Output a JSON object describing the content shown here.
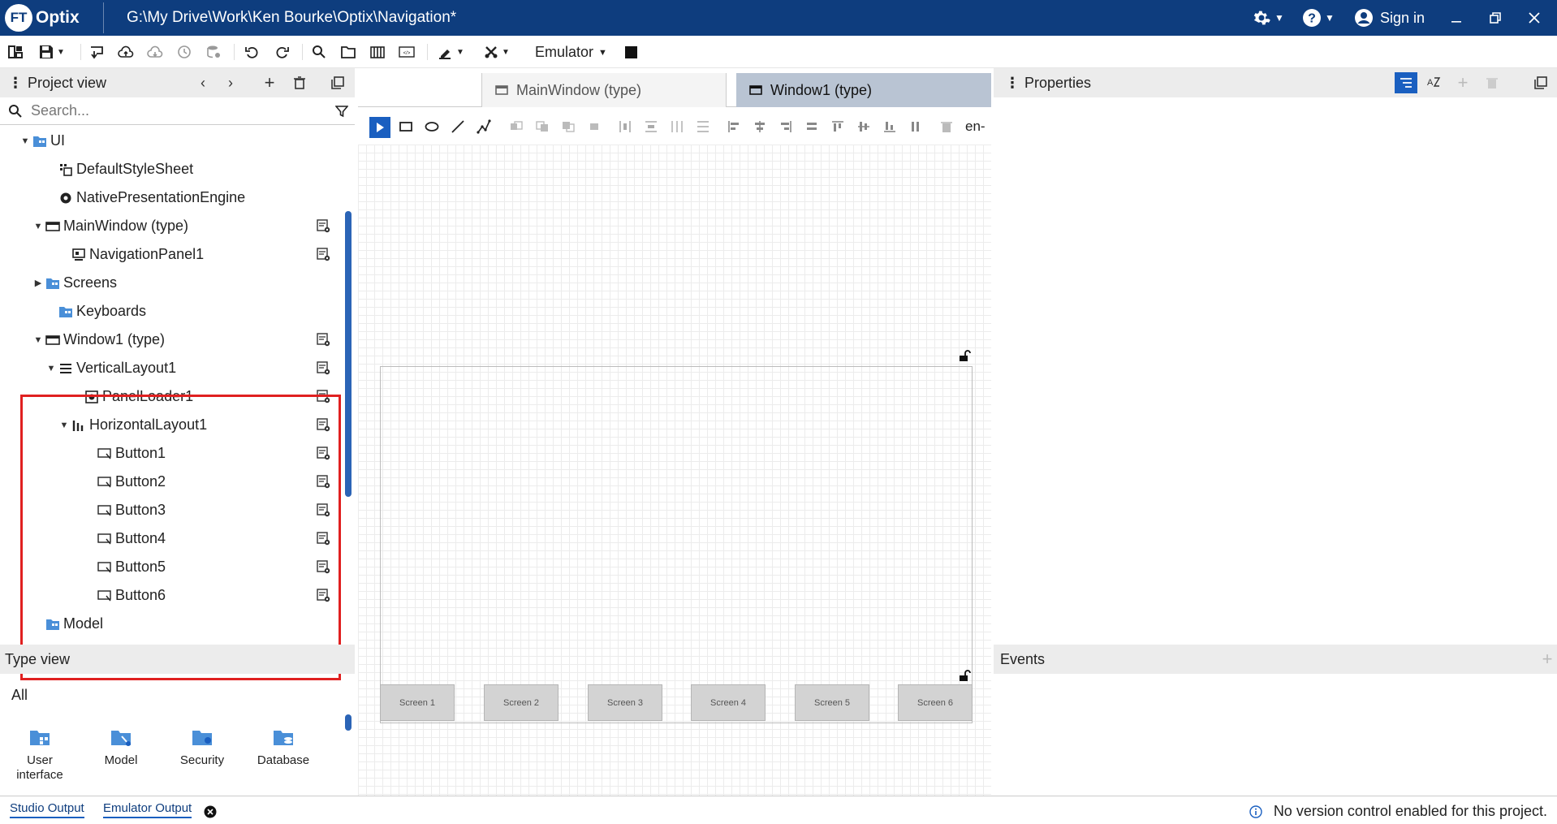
{
  "app": {
    "logo_badge": "FT",
    "logo_text": "Optix",
    "window_title": "G:\\My Drive\\Work\\Ken Bourke\\Optix\\Navigation*",
    "sign_in": "Sign in"
  },
  "toolbar": {
    "emulator_label": "Emulator"
  },
  "project_view": {
    "title": "Project view",
    "search_placeholder": "Search...",
    "tree": [
      {
        "label": "UI",
        "icon": "folder-icon"
      },
      {
        "label": "DefaultStyleSheet",
        "icon": "stylesheet-icon"
      },
      {
        "label": "NativePresentationEngine",
        "icon": "gear-icon"
      },
      {
        "label": "MainWindow (type)",
        "icon": "window-icon"
      },
      {
        "label": "NavigationPanel1",
        "icon": "navigation-panel-icon"
      },
      {
        "label": "Screens",
        "icon": "folder-icon"
      },
      {
        "label": "Keyboards",
        "icon": "folder-icon"
      },
      {
        "label": "Window1 (type)",
        "icon": "window-icon"
      },
      {
        "label": "VerticalLayout1",
        "icon": "vertical-layout-icon"
      },
      {
        "label": "PanelLoader1",
        "icon": "panel-loader-icon"
      },
      {
        "label": "HorizontalLayout1",
        "icon": "horizontal-layout-icon"
      },
      {
        "label": "Button1",
        "icon": "button-icon"
      },
      {
        "label": "Button2",
        "icon": "button-icon"
      },
      {
        "label": "Button3",
        "icon": "button-icon"
      },
      {
        "label": "Button4",
        "icon": "button-icon"
      },
      {
        "label": "Button5",
        "icon": "button-icon"
      },
      {
        "label": "Button6",
        "icon": "button-icon"
      },
      {
        "label": "Model",
        "icon": "folder-icon"
      }
    ]
  },
  "type_view": {
    "title": "Type view",
    "filter": "All",
    "items": [
      {
        "label": "User interface"
      },
      {
        "label": "Model"
      },
      {
        "label": "Security"
      },
      {
        "label": "Database"
      }
    ]
  },
  "editor": {
    "tabs": [
      {
        "label": "MainWindow (type)"
      },
      {
        "label": "Window1 (type)"
      }
    ],
    "locale": "en-",
    "screen_buttons": [
      "Screen 1",
      "Screen 2",
      "Screen 3",
      "Screen 4",
      "Screen 5",
      "Screen 6"
    ]
  },
  "properties": {
    "title": "Properties",
    "events_title": "Events"
  },
  "status": {
    "studio_output": "Studio Output",
    "emulator_output": "Emulator Output",
    "version_control_message": "No version control enabled for this project."
  },
  "colors": {
    "titlebar": "#0e3d7e",
    "accent": "#1a5fc0",
    "highlight_box": "#e02020",
    "active_tab": "#b9c4d3"
  }
}
